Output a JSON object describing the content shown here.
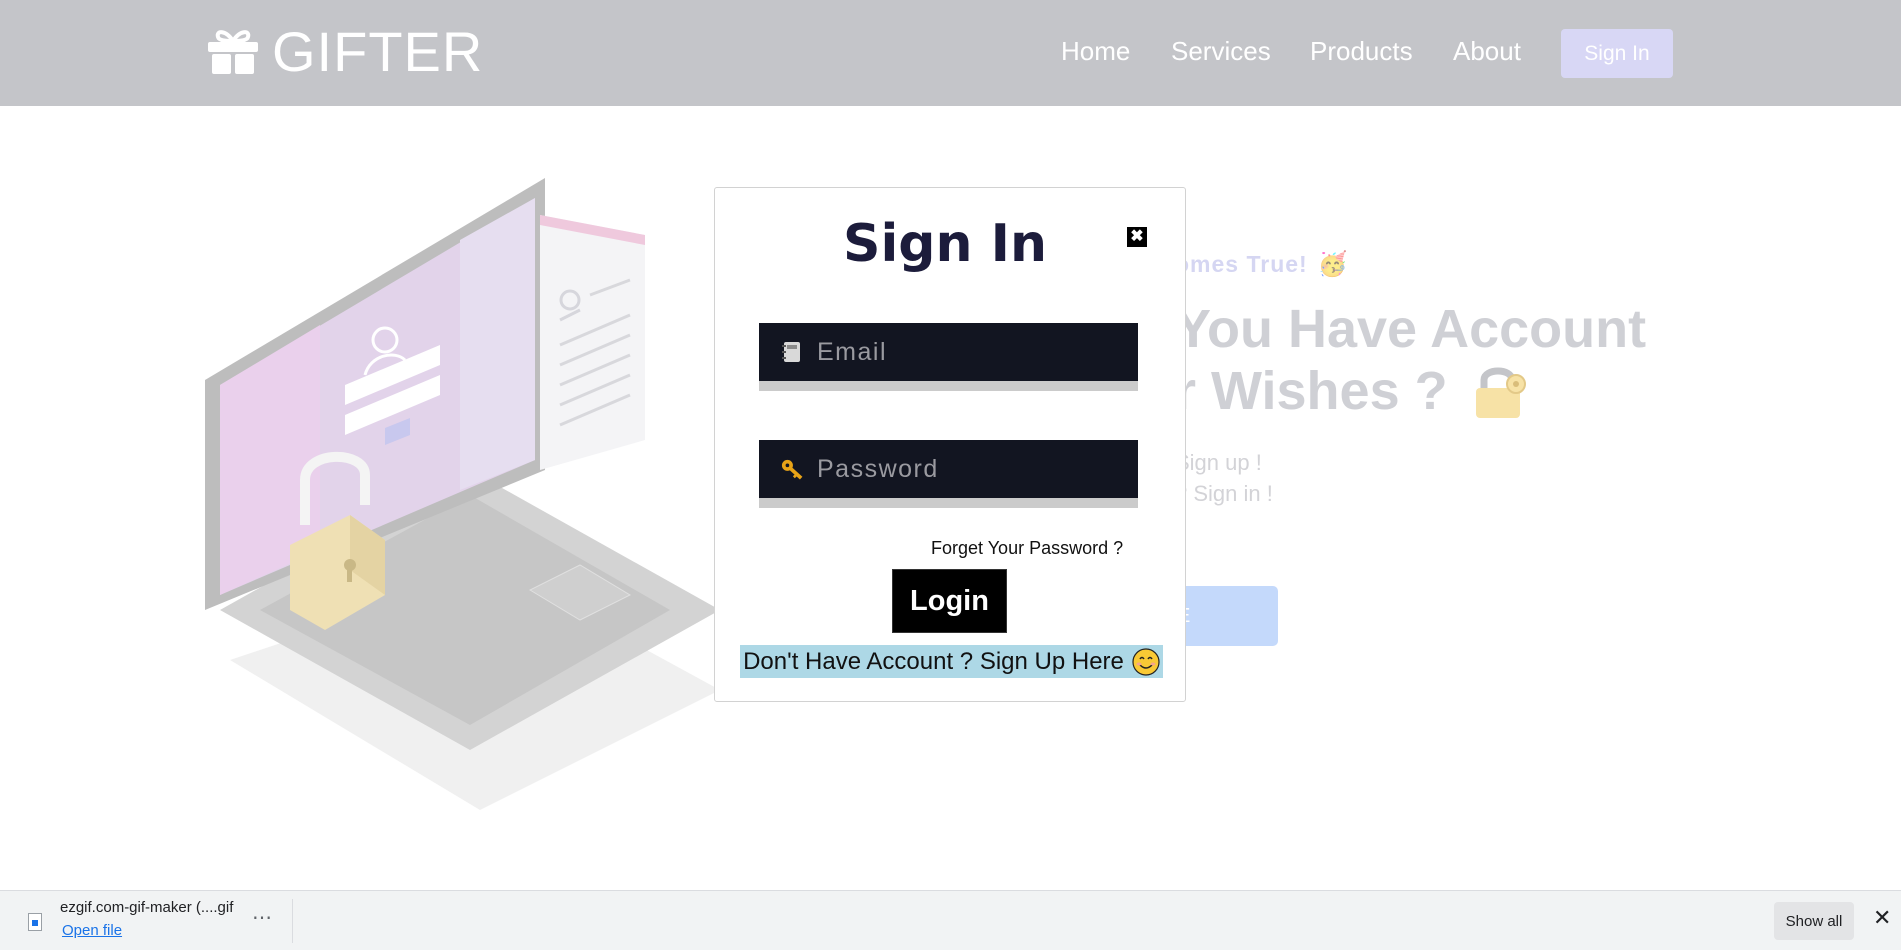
{
  "navbar": {
    "brand": "GIFTER",
    "links": [
      "Home",
      "Services",
      "Products",
      "About"
    ],
    "signin_label": "Sign In"
  },
  "hero": {
    "tagline": "omes True!",
    "heading_line1": "You Have Account",
    "heading_line2": "r Wishes ?",
    "line1": "Sign up !",
    "line2": "? Sign in !",
    "button_label": "E"
  },
  "modal": {
    "title": "Sign In",
    "close_label": "✖",
    "email_placeholder": "Email",
    "password_placeholder": "Password",
    "forgot_label": "Forget Your Password ?",
    "login_label": "Login",
    "signup_label": "Don't Have Account ? Sign Up Here"
  },
  "download_bar": {
    "file_name": "ezgif.com-gif-maker (....gif",
    "open_label": "Open file",
    "more_label": "⋯",
    "show_all_label": "Show all",
    "close_label": "✕"
  },
  "colors": {
    "navbar_bg": "#c4c5c9",
    "modal_title": "#1c1c3b",
    "field_bg": "#121521",
    "signup_bg": "#add8e6"
  }
}
